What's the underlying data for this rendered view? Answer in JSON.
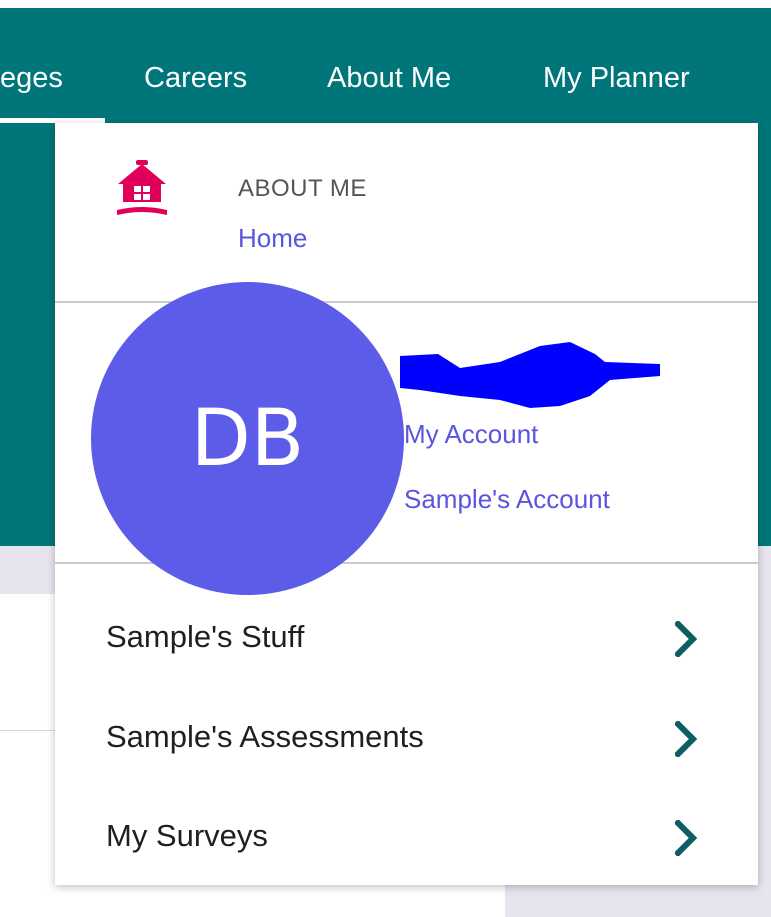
{
  "nav": {
    "items": [
      {
        "label": "eges"
      },
      {
        "label": "Careers"
      },
      {
        "label": "About Me"
      },
      {
        "label": "My Planner"
      }
    ]
  },
  "dropdown": {
    "section": {
      "title": "ABOUT ME",
      "home_link": "Home",
      "icon": "home-icon",
      "icon_color": "#e0005a"
    },
    "user": {
      "initials": "DB",
      "avatar_color": "#5c5ce8",
      "name_redacted_color": "#0000ff",
      "links": [
        "My Account",
        "Sample's Account"
      ]
    },
    "menu": [
      {
        "label": "Sample's Stuff",
        "icon": "chevron-right-icon"
      },
      {
        "label": "Sample's Assessments",
        "icon": "chevron-right-icon"
      },
      {
        "label": "My Surveys",
        "icon": "chevron-right-icon"
      }
    ]
  },
  "colors": {
    "nav_bg": "#00767a",
    "link": "#5a55e0",
    "chevron": "#0d5e62",
    "page_gray": "#e6e5ef"
  }
}
